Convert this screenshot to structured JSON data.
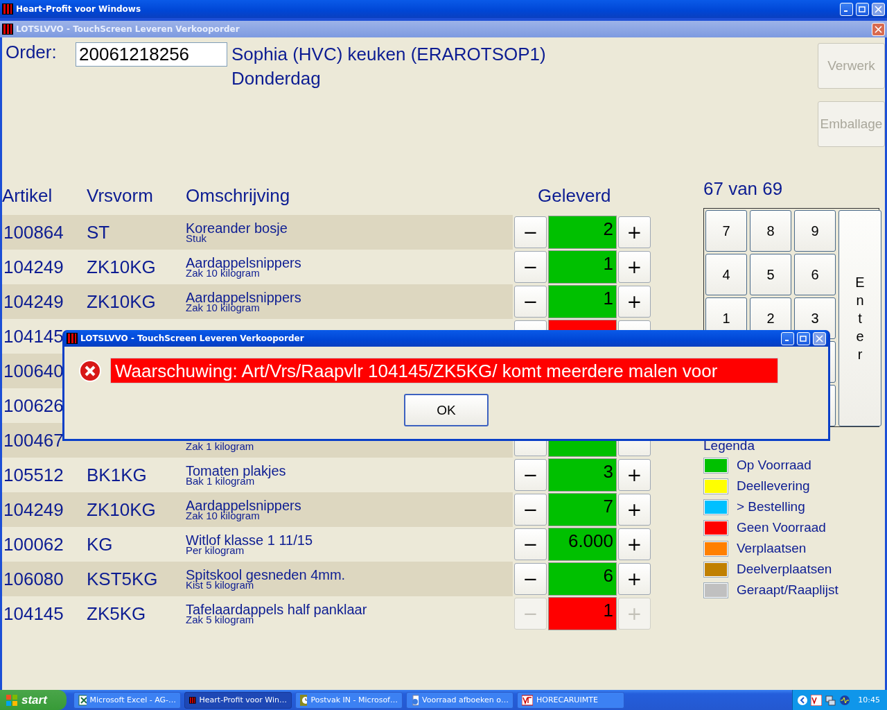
{
  "main_window": {
    "title": "Heart-Profit voor Windows"
  },
  "child_window": {
    "title": "LOTSLVVO - TouchScreen Leveren Verkooporder"
  },
  "order": {
    "label": "Order:",
    "value": "20061218256",
    "customer": "Sophia (HVC) keuken (ERAROTSOP1)",
    "day": "Donderdag"
  },
  "actions": [
    {
      "label": "Verwerk",
      "disabled": true
    },
    {
      "label": "Emballage",
      "disabled": true
    }
  ],
  "columns": [
    "Artikel",
    "Vrsvorm",
    "Omschrijving",
    "Geleverd"
  ],
  "counter": "67 van 69",
  "rows": [
    {
      "artikel": "100864",
      "vrsvorm": "ST",
      "omschrijving": "Koreander bosje",
      "eenheid": "Stuk",
      "geleverd": "2",
      "color": "#00c000",
      "minus": "−",
      "plus": "+",
      "disabled": false
    },
    {
      "artikel": "104249",
      "vrsvorm": "ZK10KG",
      "omschrijving": "Aardappelsnippers",
      "eenheid": "Zak 10 kilogram",
      "geleverd": "1",
      "color": "#00c000",
      "minus": "−",
      "plus": "+",
      "disabled": false
    },
    {
      "artikel": "104249",
      "vrsvorm": "ZK10KG",
      "omschrijving": "Aardappelsnippers",
      "eenheid": "Zak 10 kilogram",
      "geleverd": "1",
      "color": "#00c000",
      "minus": "−",
      "plus": "+",
      "disabled": false
    },
    {
      "artikel": "104145",
      "color": "#ff0000"
    },
    {
      "artikel": "100640"
    },
    {
      "artikel": "100626"
    },
    {
      "artikel": "100467",
      "eenheid": "Zak 1 kilogram",
      "color": "#00c000",
      "disabled": false
    },
    {
      "artikel": "105512",
      "vrsvorm": "BK1KG",
      "omschrijving": "Tomaten plakjes",
      "eenheid": "Bak 1 kilogram",
      "geleverd": "3",
      "color": "#00c000",
      "minus": "−",
      "plus": "+",
      "disabled": false
    },
    {
      "artikel": "104249",
      "vrsvorm": "ZK10KG",
      "omschrijving": "Aardappelsnippers",
      "eenheid": "Zak 10 kilogram",
      "geleverd": "7",
      "color": "#00c000",
      "minus": "−",
      "plus": "+",
      "disabled": false
    },
    {
      "artikel": "100062",
      "vrsvorm": "KG",
      "omschrijving": "Witlof klasse 1 11/15",
      "eenheid": "Per kilogram",
      "geleverd": "6.000",
      "color": "#00c000",
      "minus": "−",
      "plus": "+",
      "disabled": false
    },
    {
      "artikel": "106080",
      "vrsvorm": "KST5KG",
      "omschrijving": "Spitskool gesneden 4mm.",
      "eenheid": "Kist 5 kilogram",
      "geleverd": "6",
      "color": "#00c000",
      "minus": "−",
      "plus": "+",
      "disabled": false
    },
    {
      "artikel": "104145",
      "vrsvorm": "ZK5KG",
      "omschrijving": "Tafelaardappels half panklaar",
      "eenheid": "Zak 5 kilogram",
      "geleverd": "1",
      "color": "#ff0000",
      "minus": "−",
      "plus": "+",
      "disabled": true
    }
  ],
  "keypad": {
    "keys": [
      "7",
      "8",
      "9",
      "4",
      "5",
      "6",
      "1",
      "2",
      "3"
    ],
    "enter": "Enter"
  },
  "legend": {
    "title": "Legenda",
    "items": [
      {
        "label": "Op Voorraad",
        "color": "#00c000"
      },
      {
        "label": "Deellevering",
        "color": "#ffff00"
      },
      {
        "label": "> Bestelling",
        "color": "#00c0ff"
      },
      {
        "label": "Geen Voorraad",
        "color": "#ff0000"
      },
      {
        "label": "Verplaatsen",
        "color": "#ff8000"
      },
      {
        "label": "Deelverplaatsen",
        "color": "#c08000"
      },
      {
        "label": "Geraapt/Raaplijst",
        "color": "#c0c0c0"
      }
    ]
  },
  "dialog": {
    "title": "LOTSLVVO - TouchScreen Leveren Verkooporder",
    "message": "Waarschuwing: Art/Vrs/Raapvlr 104145/ZK5KG/ komt meerdere malen voor",
    "button": "OK"
  },
  "taskbar": {
    "start": "start",
    "tasks": [
      {
        "label": "Microsoft Excel - AG-…",
        "selected": false,
        "kind": "excel"
      },
      {
        "label": "Heart-Profit voor Win…",
        "selected": true,
        "kind": "app"
      },
      {
        "label": "Postvak IN - Microsof…",
        "selected": false,
        "kind": "mail"
      },
      {
        "label": "Voorraad afboeken o…",
        "selected": false,
        "kind": "web"
      },
      {
        "label": "HORECARUIMTE",
        "selected": false,
        "kind": "doc"
      }
    ],
    "clock": "10:45"
  }
}
